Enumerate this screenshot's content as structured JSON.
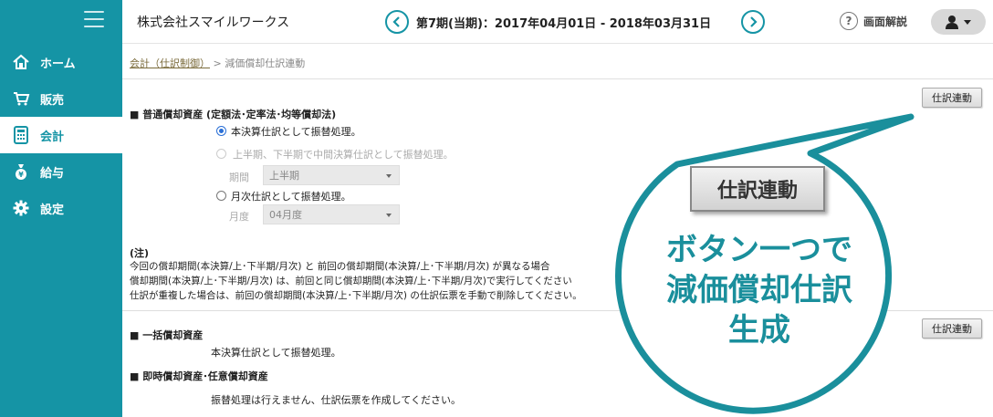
{
  "sidebar": {
    "items": [
      {
        "label": "ホーム",
        "icon": "home-icon"
      },
      {
        "label": "販売",
        "icon": "cart-icon"
      },
      {
        "label": "会計",
        "icon": "calculator-icon"
      },
      {
        "label": "給与",
        "icon": "money-bag-icon"
      },
      {
        "label": "設定",
        "icon": "gear-icon"
      }
    ],
    "active_index": 2,
    "color": "#1594a5"
  },
  "header": {
    "company": "株式会社スマイルワークス",
    "period": "第7期(当期)：2017年04月01日 - 2018年03月31日",
    "help_label": "画面解説"
  },
  "breadcrumb": {
    "parent": "会計（仕訳制御）",
    "separator": ">",
    "current": "減価償却仕訳連動"
  },
  "section1": {
    "title": "■ 普通償却資産 (定額法･定率法･均等償却法)",
    "button": "仕訳連動",
    "option1": "本決算仕訳として振替処理。",
    "option2": "上半期、下半期で中間決算仕訳として振替処理。",
    "period_label": "期間",
    "period_value": "上半期",
    "option3": "月次仕訳として振替処理。",
    "month_label": "月度",
    "month_value": "04月度"
  },
  "note": {
    "heading": "(注)",
    "line1": "今回の償却期間(本決算/上･下半期/月次) と 前回の償却期間(本決算/上･下半期/月次) が異なる場合",
    "line2": "償却期間(本決算/上･下半期/月次) は、前回と同じ償却期間(本決算/上･下半期/月次)で実行してください",
    "line3": "仕訳が重複した場合は、前回の償却期間(本決算/上･下半期/月次) の仕訳伝票を手動で削除してください。"
  },
  "section2": {
    "title": "■ 一括償却資産",
    "button": "仕訳連動",
    "text": "本決算仕訳として振替処理。"
  },
  "section3": {
    "title": "■ 即時償却資産･任意償却資産",
    "text": "振替処理は行えません、仕訳伝票を作成してください。"
  },
  "callout": {
    "button_label": "仕訳連動",
    "line1": "ボタン一つで",
    "line2": "減価償却仕訳",
    "line3": "生成",
    "color": "#1a8f9c"
  }
}
